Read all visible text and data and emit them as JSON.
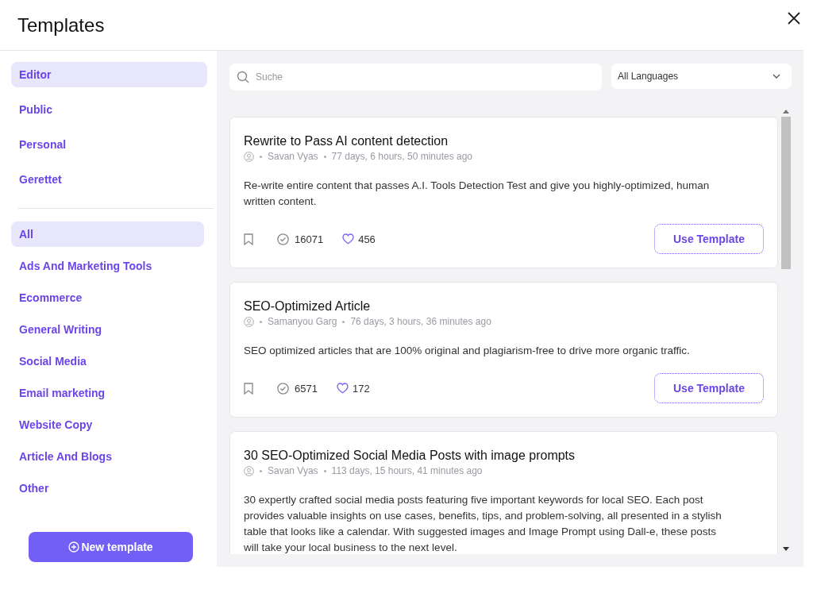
{
  "dialog": {
    "title": "Templates"
  },
  "sidebar": {
    "filters": [
      {
        "label": "Editor",
        "selected": true
      },
      {
        "label": "Public",
        "selected": false
      },
      {
        "label": "Personal",
        "selected": false
      },
      {
        "label": "Gerettet",
        "selected": false
      }
    ],
    "categories": [
      {
        "label": "All",
        "selected": true
      },
      {
        "label": "Ads And Marketing Tools",
        "selected": false
      },
      {
        "label": "Ecommerce",
        "selected": false
      },
      {
        "label": "General Writing",
        "selected": false
      },
      {
        "label": "Social Media",
        "selected": false
      },
      {
        "label": "Email marketing",
        "selected": false
      },
      {
        "label": "Website Copy",
        "selected": false
      },
      {
        "label": "Article And Blogs",
        "selected": false
      },
      {
        "label": "Other",
        "selected": false
      }
    ],
    "new_button": "New template"
  },
  "search": {
    "placeholder": "Suche"
  },
  "language": {
    "value": "All Languages"
  },
  "templates": [
    {
      "title": "Rewrite to Pass AI content detection",
      "author": "Savan Vyas",
      "age": "77 days, 6 hours, 50 minutes ago",
      "description": "Re-write entire content that passes A.I. Tools Detection Test and give you highly-optimized, human written content.",
      "uses": "16071",
      "likes": "456",
      "button": "Use Template"
    },
    {
      "title": "SEO-Optimized Article",
      "author": "Samanyou Garg",
      "age": "76 days, 3 hours, 36 minutes ago",
      "description": "SEO optimized articles that are 100% original and plagiarism-free to drive more organic traffic.",
      "uses": "6571",
      "likes": "172",
      "button": "Use Template"
    },
    {
      "title": "30 SEO-Optimized Social Media Posts with image prompts",
      "author": "Savan Vyas",
      "age": "113 days, 15 hours, 41 minutes ago",
      "description": "30 expertly crafted social media posts featuring five important keywords for local SEO. Each post provides valuable insights on use cases, benefits, tips, and problem-solving, all presented in a stylish table that looks like a calendar. With suggested images and Image Prompt using Dall-e, these posts will take your local business to the next level."
    }
  ]
}
